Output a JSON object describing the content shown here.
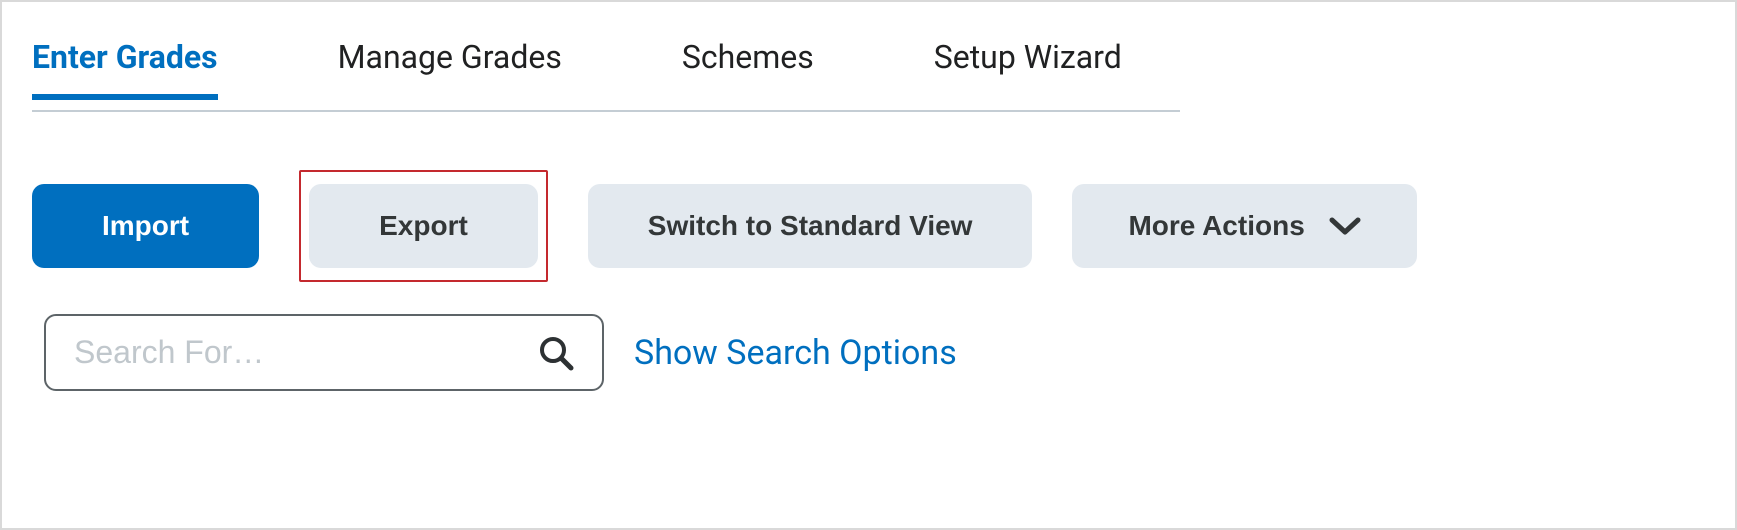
{
  "tabs": {
    "items": [
      {
        "label": "Enter Grades",
        "active": true
      },
      {
        "label": "Manage Grades",
        "active": false
      },
      {
        "label": "Schemes",
        "active": false
      },
      {
        "label": "Setup Wizard",
        "active": false
      }
    ]
  },
  "buttons": {
    "import": "Import",
    "export": "Export",
    "switch_view": "Switch to Standard View",
    "more_actions": "More Actions"
  },
  "search": {
    "placeholder": "Search For…",
    "value": "",
    "options_link": "Show Search Options"
  },
  "colors": {
    "primary": "#006fbf",
    "secondary_bg": "#e3e9ef",
    "highlight_border": "#c4292e"
  }
}
